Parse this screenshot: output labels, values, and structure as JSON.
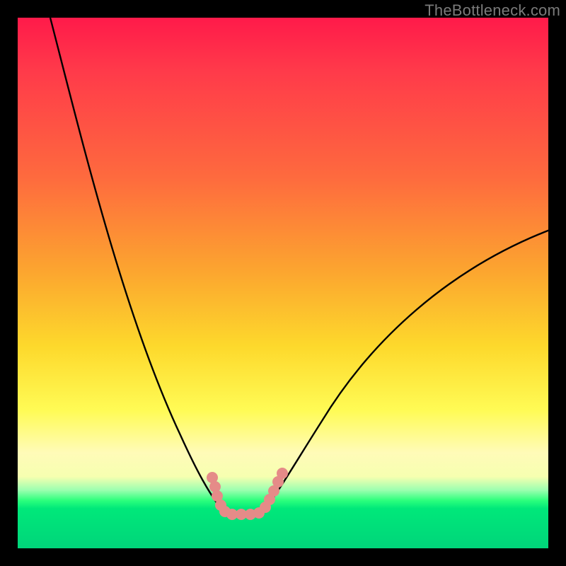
{
  "attribution": "TheBottleneck.com",
  "chart_data": {
    "type": "line",
    "title": "",
    "xlabel": "",
    "ylabel": "",
    "x": [
      0.0,
      0.05,
      0.1,
      0.15,
      0.2,
      0.25,
      0.3,
      0.32,
      0.35,
      0.38,
      0.4,
      0.45,
      0.5,
      0.55,
      0.6,
      0.65,
      0.7,
      0.75,
      0.8,
      0.85,
      0.9,
      0.95,
      1.0
    ],
    "series": [
      {
        "name": "curve",
        "values": [
          1.0,
          0.84,
          0.69,
          0.55,
          0.41,
          0.28,
          0.15,
          0.1,
          0.05,
          0.02,
          0.0,
          0.0,
          0.02,
          0.06,
          0.12,
          0.18,
          0.24,
          0.3,
          0.36,
          0.42,
          0.48,
          0.54,
          0.6
        ]
      }
    ],
    "xlim": [
      0,
      1
    ],
    "ylim": [
      0,
      1
    ],
    "flat_segment_x": [
      0.38,
      0.45
    ],
    "marker_color": "#e58b88",
    "curve_color": "#000000",
    "background_gradient": [
      "#ff1a4a",
      "#fca62f",
      "#fffb55",
      "#00e87a"
    ]
  }
}
